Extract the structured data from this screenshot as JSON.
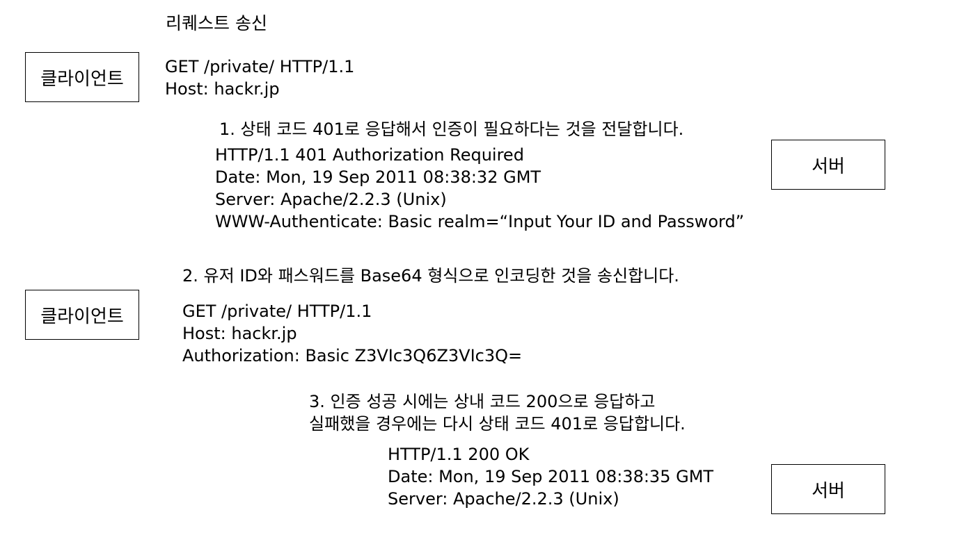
{
  "request_title": "리퀘스트 송신",
  "client_label": "클라이언트",
  "server_label": "서버",
  "step1": {
    "request_lines": [
      "GET /private/ HTTP/1.1",
      "Host: hackr.jp"
    ],
    "caption": "1. 상태 코드 401로 응답해서 인증이 필요하다는 것을 전달합니다.",
    "response_lines": [
      "HTTP/1.1 401 Authorization Required",
      "Date: Mon, 19 Sep 2011 08:38:32 GMT",
      "Server: Apache/2.2.3 (Unix)",
      "WWW-Authenticate: Basic realm=“Input Your ID and Password”"
    ]
  },
  "step2": {
    "caption": "2. 유저 ID와 패스워드를 Base64 형식으로 인코딩한 것을 송신합니다.",
    "request_lines": [
      "GET /private/ HTTP/1.1",
      "Host: hackr.jp",
      "Authorization: Basic Z3VIc3Q6Z3VIc3Q="
    ]
  },
  "step3": {
    "caption_lines": [
      "3. 인증 성공 시에는 상내 코드 200으로 응답하고",
      "실패했을 경우에는 다시 상태 코드 401로 응답합니다."
    ],
    "response_lines": [
      "HTTP/1.1 200 OK",
      "Date: Mon, 19 Sep 2011 08:38:35 GMT",
      "Server: Apache/2.2.3 (Unix)"
    ]
  }
}
